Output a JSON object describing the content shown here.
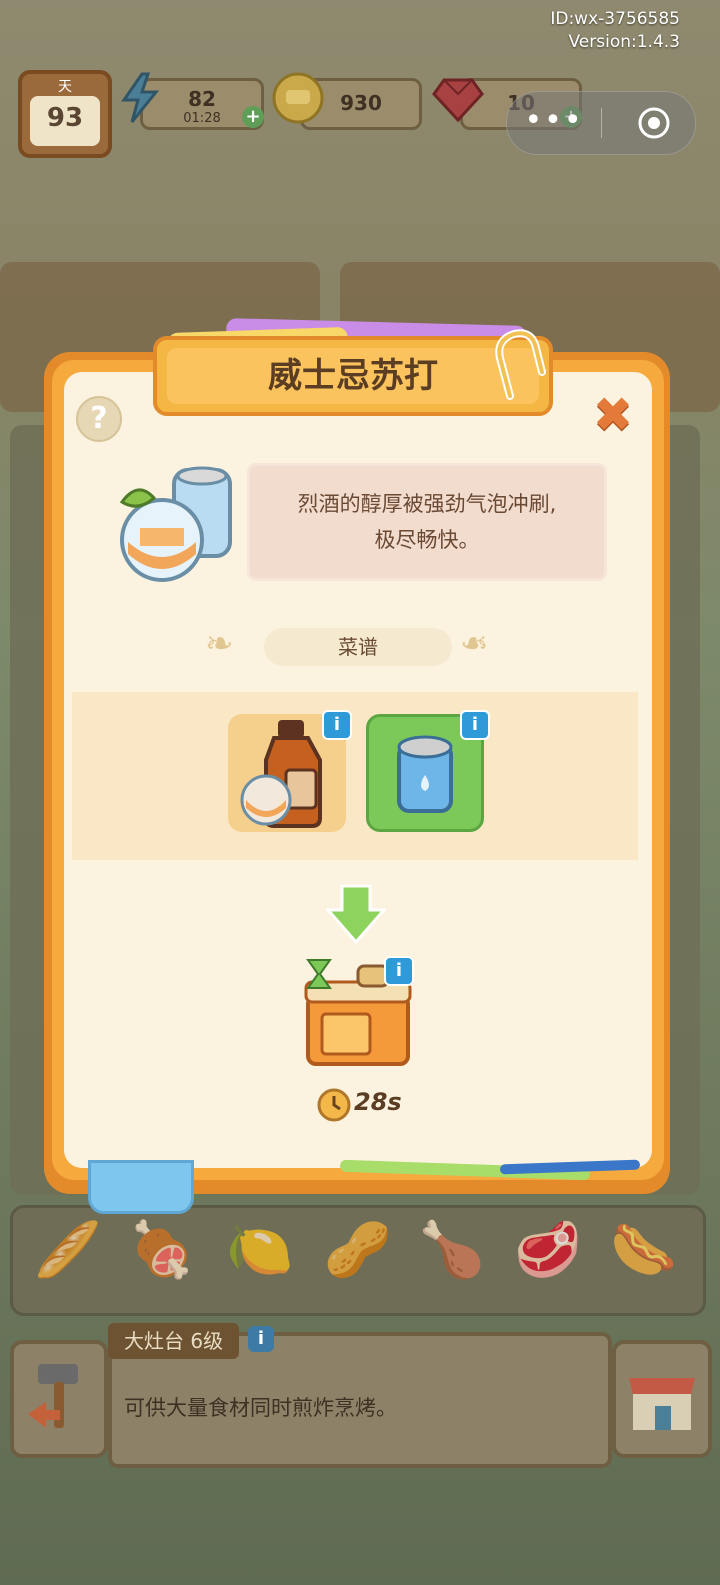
{
  "system": {
    "id_text": "ID:wx-3756585",
    "version_text": "Version:1.4.3"
  },
  "resources": {
    "day_label": "天",
    "day_value": "93",
    "energy_value": "82",
    "energy_timer": "01:28",
    "coins_value": "930",
    "gems_value": "10"
  },
  "modal": {
    "title": "威士忌苏打",
    "description_line1": "烈酒的醇厚被强劲气泡冲刷,",
    "description_line2": "极尽畅快。",
    "recipe_label": "菜谱",
    "cook_time": "28s",
    "help_symbol": "?",
    "close_symbol": "✖",
    "info_symbol": "i",
    "ingredients": [
      {
        "icon": "whiskey-bottle-icon",
        "bg": "#f5cf8c"
      },
      {
        "icon": "soda-can-icon",
        "bg": "#7cc95a"
      }
    ]
  },
  "bottom": {
    "station_title": "大灶台 6级",
    "station_desc": "可供大量食材同时煎炸烹烤。",
    "info_symbol": "i",
    "items": [
      "🥖",
      "🍖",
      "🍋",
      "🥜",
      "🍗",
      "🥩",
      "🌭"
    ]
  }
}
